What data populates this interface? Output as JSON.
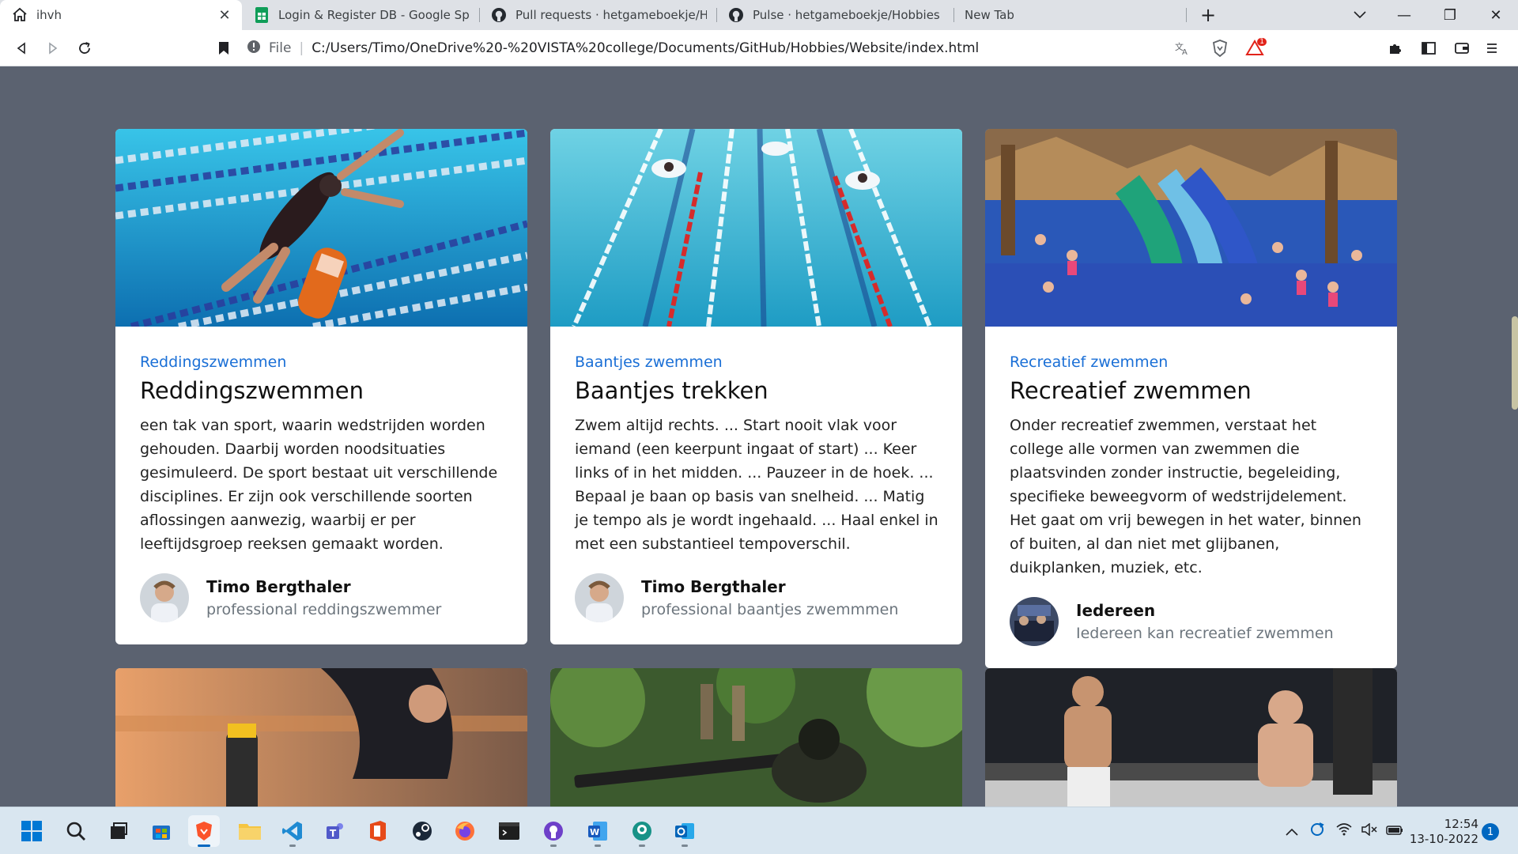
{
  "browser": {
    "tabs": [
      {
        "label": "ihvh",
        "icon": "home-icon",
        "active": true
      },
      {
        "label": "Login & Register DB - Google Spreads",
        "icon": "google-sheets-icon"
      },
      {
        "label": "Pull requests · hetgameboekje/Hobbie",
        "icon": "github-icon"
      },
      {
        "label": "Pulse · hetgameboekje/Hobbies",
        "icon": "github-icon"
      },
      {
        "label": "New Tab",
        "icon": ""
      }
    ],
    "new_tab_symbol": "+",
    "window_controls": {
      "minimize": "—",
      "restore": "❐",
      "close": "✕"
    },
    "address": {
      "security_label": "File",
      "url": "C:/Users/Timo/OneDrive%20-%20VISTA%20college/Documents/GitHub/Hobbies/Website/index.html"
    },
    "extension_badge": "1"
  },
  "cards": [
    {
      "category": "Reddingszwemmen",
      "title": "Reddingszwemmen",
      "text": "een tak van sport, waarin wedstrijden worden gehouden. Daarbij worden noodsituaties gesimuleerd. De sport bestaat uit verschillende disciplines. Er zijn ook verschillende soorten aflossingen aanwezig, waarbij er per leeftijdsgroep reeksen gemaakt worden.",
      "author": {
        "name": "Timo Bergthaler",
        "role": "professional reddingszwemmer"
      }
    },
    {
      "category": "Baantjes zwemmen",
      "title": "Baantjes trekken",
      "text": "Zwem altijd rechts. ... Start nooit vlak voor iemand (een keerpunt ingaat of start) ... Keer links of in het midden. ... Pauzeer in de hoek. ... Bepaal je baan op basis van snelheid. ... Matig je tempo als je wordt ingehaald. ... Haal enkel in met een substantieel tempoverschil.",
      "author": {
        "name": "Timo Bergthaler",
        "role": "professional baantjes zwemmmen"
      }
    },
    {
      "category": "Recreatief zwemmen",
      "title": "Recreatief zwemmen",
      "text": "Onder recreatief zwemmen, verstaat het college alle vormen van zwemmen die plaatsvinden zonder instructie, begeleiding, specifieke beweegvorm of wedstrijdelement. Het gaat om vrij bewegen in het water, binnen of buiten, al dan niet met glijbanen, duikplanken, muziek, etc.",
      "author": {
        "name": "Iedereen",
        "role": "Iedereen kan recreatief zwemmen"
      }
    }
  ],
  "taskbar": {
    "apps": [
      "windows-start-icon",
      "search-icon",
      "task-view-icon",
      "microsoft-store-icon",
      "brave-browser-icon",
      "file-explorer-icon",
      "vscode-icon",
      "teams-icon",
      "office-icon",
      "steam-icon",
      "firefox-icon",
      "terminal-icon",
      "github-desktop-icon",
      "word-icon",
      "gitkraken-icon",
      "outlook-icon"
    ],
    "time": "12:54",
    "date": "13-10-2022",
    "notifications": "1"
  },
  "colors": {
    "page_background": "#5b6270",
    "category_link": "#1a6fd6",
    "taskbar": "#d9e6f0"
  }
}
